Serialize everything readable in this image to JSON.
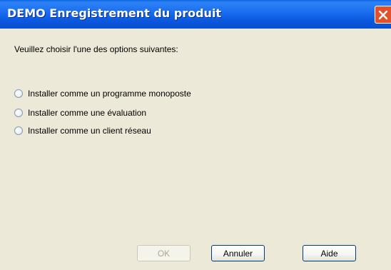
{
  "window": {
    "title": "DEMO Enregistrement du produit"
  },
  "prompt": "Veuillez choisir l'une des options suivantes:",
  "options": [
    {
      "label": "Installer comme un programme monoposte"
    },
    {
      "label": "Installer comme une évaluation"
    },
    {
      "label": "Installer comme un client réseau"
    }
  ],
  "buttons": {
    "ok": "OK",
    "cancel": "Annuler",
    "help": "Aide"
  },
  "colors": {
    "titlebar": "#0a5fe0",
    "close": "#e3512c",
    "dialog_bg": "#ece9d8"
  },
  "icons": {
    "close": "close-icon"
  }
}
